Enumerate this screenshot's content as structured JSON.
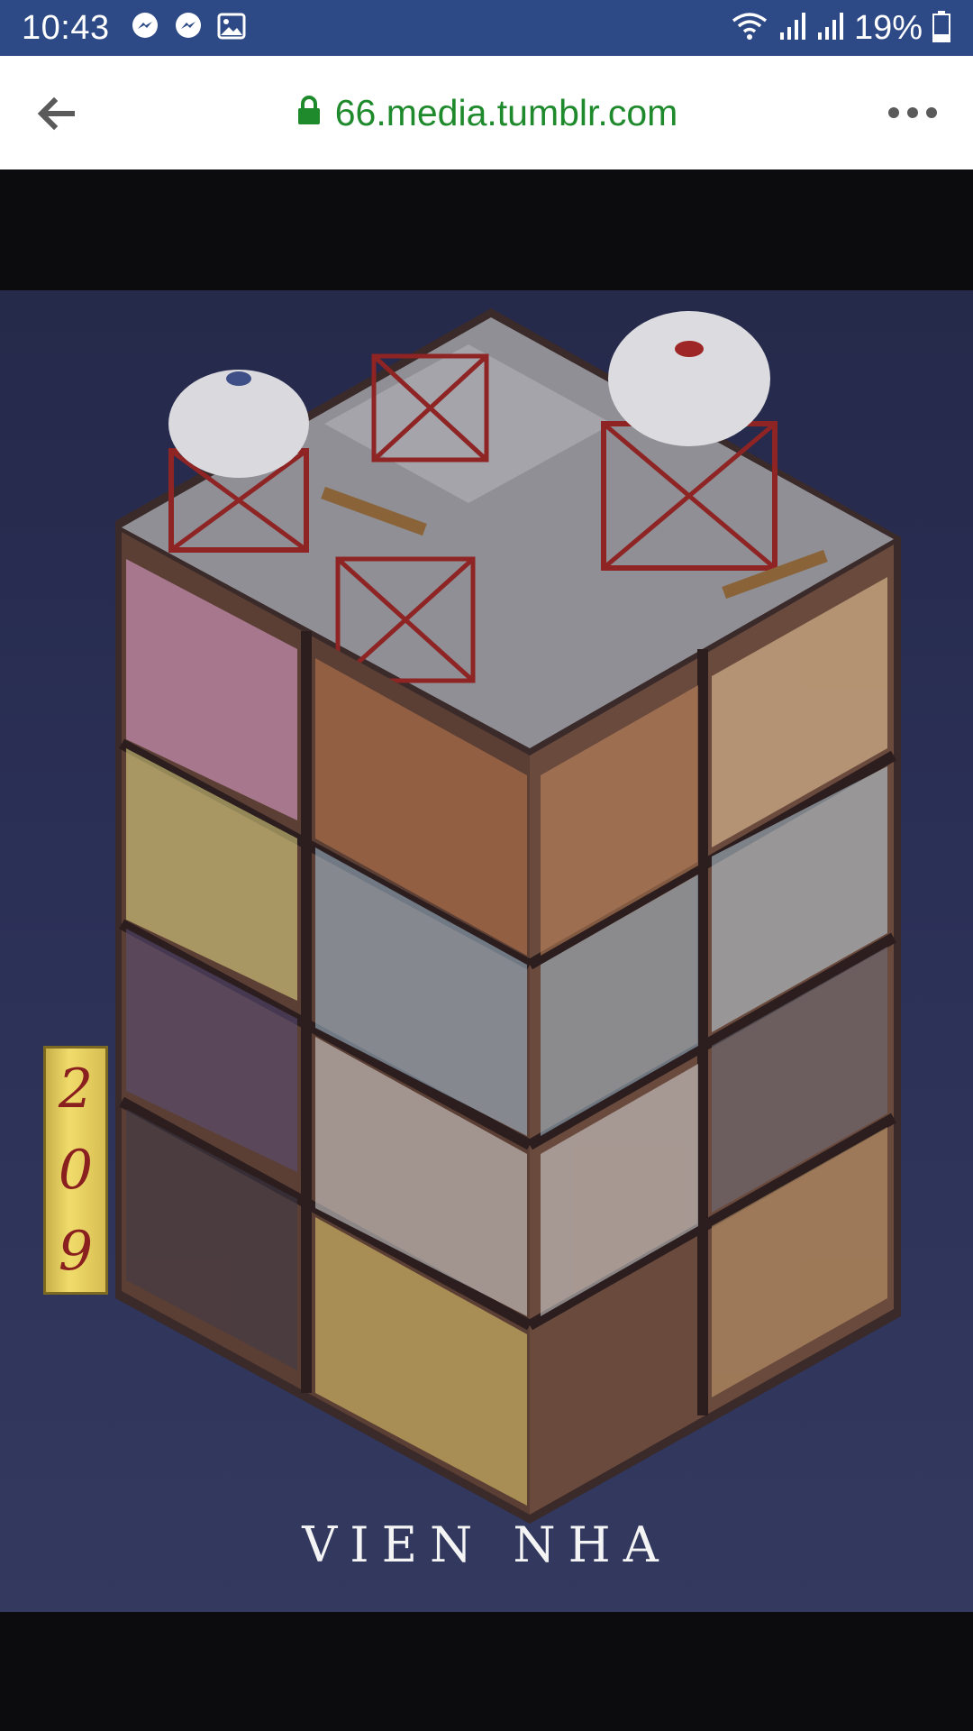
{
  "status_bar": {
    "time": "10:43",
    "notification_icons": [
      "messenger-icon",
      "messenger-icon",
      "gallery-icon"
    ],
    "system_icons": [
      "wifi-icon",
      "signal-icon",
      "signal-icon"
    ],
    "battery": "19%"
  },
  "browser": {
    "url": "66.media.tumblr.com",
    "secure": true,
    "accent_color": "#1e8a2c",
    "back_icon": "back-arrow-icon",
    "menu_icon": "more-options-icon"
  },
  "artwork": {
    "building_number": [
      "2",
      "0",
      "9"
    ],
    "caption": "VIEN NHA",
    "background_color": "#2b3057"
  }
}
